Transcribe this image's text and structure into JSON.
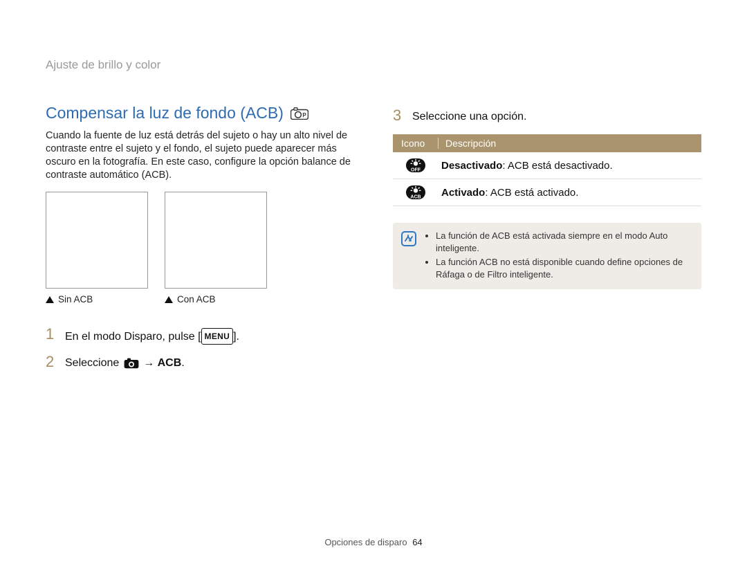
{
  "breadcrumb": "Ajuste de brillo y color",
  "heading": "Compensar la luz de fondo (ACB)",
  "intro": "Cuando la fuente de luz está detrás del sujeto o hay un alto nivel de contraste entre el sujeto y el fondo, el sujeto puede aparecer más oscuro en la fotografía. En este caso, configure la opción balance de contraste automático (ACB).",
  "images": {
    "left_caption": "Sin ACB",
    "right_caption": "Con ACB"
  },
  "steps": {
    "s1_pre": "En el modo Disparo, pulse [",
    "s1_chip": "MENU",
    "s1_post": "].",
    "s2_pre": "Seleccione ",
    "s2_arrow": " → ",
    "s2_bold": "ACB",
    "s2_tail": ".",
    "s3": "Seleccione una opción."
  },
  "table": {
    "h1": "Icono",
    "h2": "Descripción",
    "row1_bold": "Desactivado",
    "row1_rest": ": ACB está desactivado.",
    "row2_bold": "Activado",
    "row2_rest": ": ACB está activado."
  },
  "notes": {
    "n1": "La función de ACB está activada siempre en el modo Auto inteligente.",
    "n2": "La función ACB no está disponible cuando define opciones de Ráfaga o de Filtro inteligente."
  },
  "footer": {
    "section": "Opciones de disparo",
    "page": "64"
  }
}
